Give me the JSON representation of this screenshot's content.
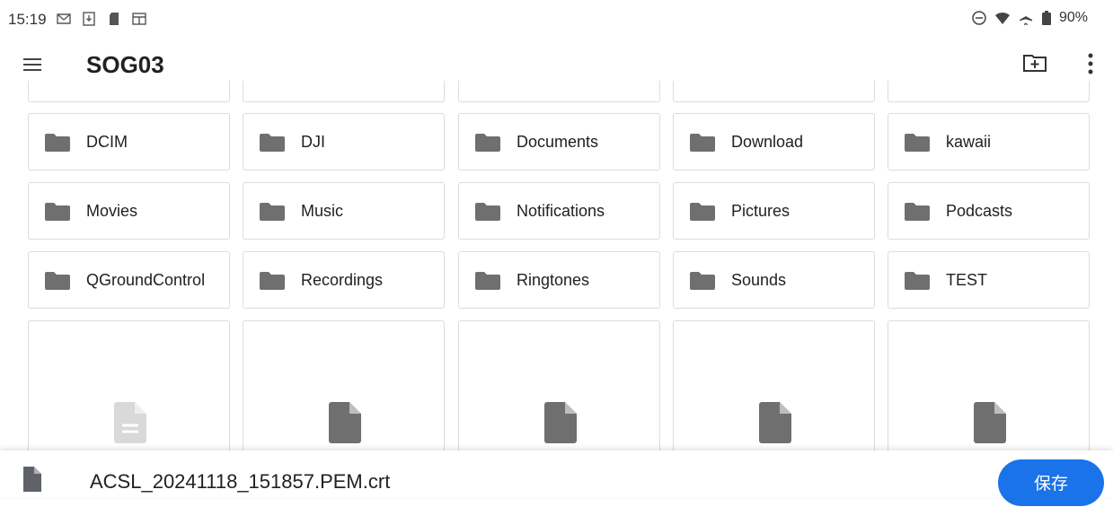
{
  "status_bar": {
    "time": "15:19",
    "left_icons": [
      "gmail-icon",
      "download-icon",
      "sd-card-icon",
      "window-icon"
    ],
    "right_icons": [
      "dnd-icon",
      "wifi-icon",
      "airplane-icon",
      "battery-icon"
    ],
    "battery": "90%"
  },
  "app_bar": {
    "title": "SOG03",
    "menu_icon": "menu-icon",
    "new_folder_icon": "new-folder-icon",
    "more_icon": "more-vert-icon"
  },
  "folders": [
    [
      "DCIM",
      "DJI",
      "Documents",
      "Download",
      "kawaii"
    ],
    [
      "Movies",
      "Music",
      "Notifications",
      "Pictures",
      "Podcasts"
    ],
    [
      "QGroundControl",
      "Recordings",
      "Ringtones",
      "Sounds",
      "TEST"
    ]
  ],
  "files": [
    {
      "icon": "text-document-icon",
      "dimmed": true
    },
    {
      "icon": "document-icon",
      "dimmed": false
    },
    {
      "icon": "document-icon",
      "dimmed": false
    },
    {
      "icon": "document-icon",
      "dimmed": false
    },
    {
      "icon": "document-icon",
      "dimmed": false
    }
  ],
  "bottom_bar": {
    "filename": "ACSL_20241118_151857.PEM.crt",
    "save_label": "保存"
  },
  "colors": {
    "accent": "#1a73e8",
    "folder_icon": "#6f6f6f",
    "tile_border": "#dadce0"
  }
}
